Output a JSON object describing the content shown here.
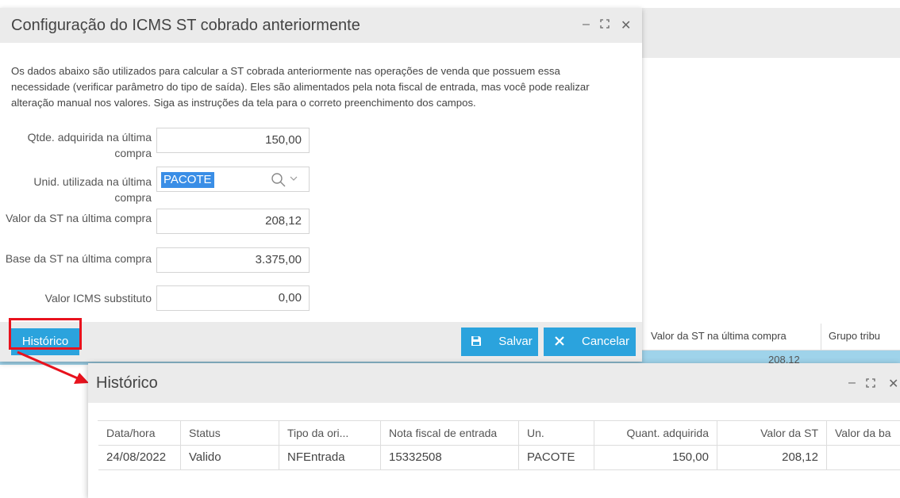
{
  "background": {
    "columns": [
      "Valor da ST na última compra",
      "Grupo tribu"
    ],
    "row_value": "208,12",
    "row_left_text": "..."
  },
  "dialog1": {
    "title": "Configuração do ICMS ST cobrado anteriormente",
    "controls": {
      "minimize": "–",
      "maximize": "⛶",
      "close": "✕"
    },
    "description": "Os dados abaixo são utilizados para calcular a ST cobrada anteriormente nas operações de venda que possuem essa necessidade (verificar parâmetro do tipo de saída). Eles são alimentados pela nota fiscal de entrada, mas você pode realizar alteração manual nos valores. Siga as instruções da tela para o correto preenchimento dos campos.",
    "fields": [
      {
        "label": "Qtde. adquirida na última compra",
        "value": "150,00"
      },
      {
        "label": "Unid. utilizada na última compra",
        "value": "PACOTE"
      },
      {
        "label": "Valor da ST na última compra",
        "value": "208,12"
      },
      {
        "label": "Base da ST na última compra",
        "value": "3.375,00"
      },
      {
        "label": "Valor ICMS substituto",
        "value": "0,00"
      }
    ],
    "buttons": {
      "historico": "Histórico",
      "salvar": "Salvar",
      "cancelar": "Cancelar"
    },
    "colors": {
      "button": "#2ba3dd",
      "highlight": "#e8121d"
    }
  },
  "dialog2": {
    "title": "Histórico",
    "controls": {
      "minimize": "–",
      "maximize": "⛶",
      "close": "✕"
    },
    "columns": [
      "Data/hora",
      "Status",
      "Tipo da ori...",
      "Nota fiscal de entrada",
      "Un.",
      "Quant. adquirida",
      "Valor da ST",
      "Valor da ba"
    ],
    "rows": [
      [
        "24/08/2022",
        "Valido",
        "NFEntrada",
        "15332508",
        "PACOTE",
        "150,00",
        "208,12",
        ""
      ]
    ]
  }
}
